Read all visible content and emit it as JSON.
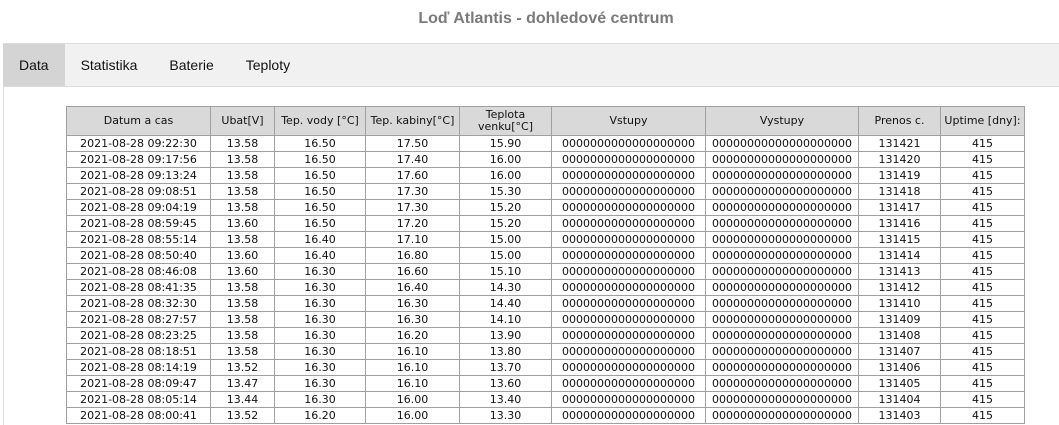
{
  "title": "Loď Atlantis - dohledové centrum",
  "tabs": [
    {
      "label": "Data",
      "active": true
    },
    {
      "label": "Statistika",
      "active": false
    },
    {
      "label": "Baterie",
      "active": false
    },
    {
      "label": "Teploty",
      "active": false
    }
  ],
  "table": {
    "headers": [
      "Datum a cas",
      "Ubat[V]",
      "Tep. vody [°C]",
      "Tep. kabiny[°C]",
      "Teplota venku[°C]",
      "Vstupy",
      "Vystupy",
      "Prenos c.",
      "Uptime [dny]:"
    ],
    "rows": [
      [
        "2021-08-28 09:22:30",
        "13.58",
        "16.50",
        "17.50",
        "15.90",
        "0000000000000000000",
        "00000000000000000000",
        "131421",
        "415"
      ],
      [
        "2021-08-28 09:17:56",
        "13.58",
        "16.50",
        "17.40",
        "16.00",
        "0000000000000000000",
        "00000000000000000000",
        "131420",
        "415"
      ],
      [
        "2021-08-28 09:13:24",
        "13.58",
        "16.50",
        "17.60",
        "16.00",
        "0000000000000000000",
        "00000000000000000000",
        "131419",
        "415"
      ],
      [
        "2021-08-28 09:08:51",
        "13.58",
        "16.50",
        "17.30",
        "15.30",
        "0000000000000000000",
        "00000000000000000000",
        "131418",
        "415"
      ],
      [
        "2021-08-28 09:04:19",
        "13.58",
        "16.50",
        "17.30",
        "15.20",
        "0000000000000000000",
        "00000000000000000000",
        "131417",
        "415"
      ],
      [
        "2021-08-28 08:59:45",
        "13.60",
        "16.50",
        "17.20",
        "15.20",
        "0000000000000000000",
        "00000000000000000000",
        "131416",
        "415"
      ],
      [
        "2021-08-28 08:55:14",
        "13.58",
        "16.40",
        "17.10",
        "15.00",
        "0000000000000000000",
        "00000000000000000000",
        "131415",
        "415"
      ],
      [
        "2021-08-28 08:50:40",
        "13.60",
        "16.40",
        "16.80",
        "15.00",
        "0000000000000000000",
        "00000000000000000000",
        "131414",
        "415"
      ],
      [
        "2021-08-28 08:46:08",
        "13.60",
        "16.30",
        "16.60",
        "15.10",
        "0000000000000000000",
        "00000000000000000000",
        "131413",
        "415"
      ],
      [
        "2021-08-28 08:41:35",
        "13.58",
        "16.30",
        "16.40",
        "14.30",
        "0000000000000000000",
        "00000000000000000000",
        "131412",
        "415"
      ],
      [
        "2021-08-28 08:32:30",
        "13.58",
        "16.30",
        "16.30",
        "14.40",
        "0000000000000000000",
        "00000000000000000000",
        "131410",
        "415"
      ],
      [
        "2021-08-28 08:27:57",
        "13.58",
        "16.30",
        "16.30",
        "14.10",
        "0000000000000000000",
        "00000000000000000000",
        "131409",
        "415"
      ],
      [
        "2021-08-28 08:23:25",
        "13.58",
        "16.30",
        "16.20",
        "13.90",
        "0000000000000000000",
        "00000000000000000000",
        "131408",
        "415"
      ],
      [
        "2021-08-28 08:18:51",
        "13.58",
        "16.30",
        "16.10",
        "13.80",
        "0000000000000000000",
        "00000000000000000000",
        "131407",
        "415"
      ],
      [
        "2021-08-28 08:14:19",
        "13.52",
        "16.30",
        "16.10",
        "13.70",
        "0000000000000000000",
        "00000000000000000000",
        "131406",
        "415"
      ],
      [
        "2021-08-28 08:09:47",
        "13.47",
        "16.30",
        "16.10",
        "13.60",
        "0000000000000000000",
        "00000000000000000000",
        "131405",
        "415"
      ],
      [
        "2021-08-28 08:05:14",
        "13.44",
        "16.30",
        "16.00",
        "13.40",
        "0000000000000000000",
        "00000000000000000000",
        "131404",
        "415"
      ],
      [
        "2021-08-28 08:00:41",
        "13.52",
        "16.20",
        "16.00",
        "13.30",
        "0000000000000000000",
        "00000000000000000000",
        "131403",
        "415"
      ]
    ]
  }
}
